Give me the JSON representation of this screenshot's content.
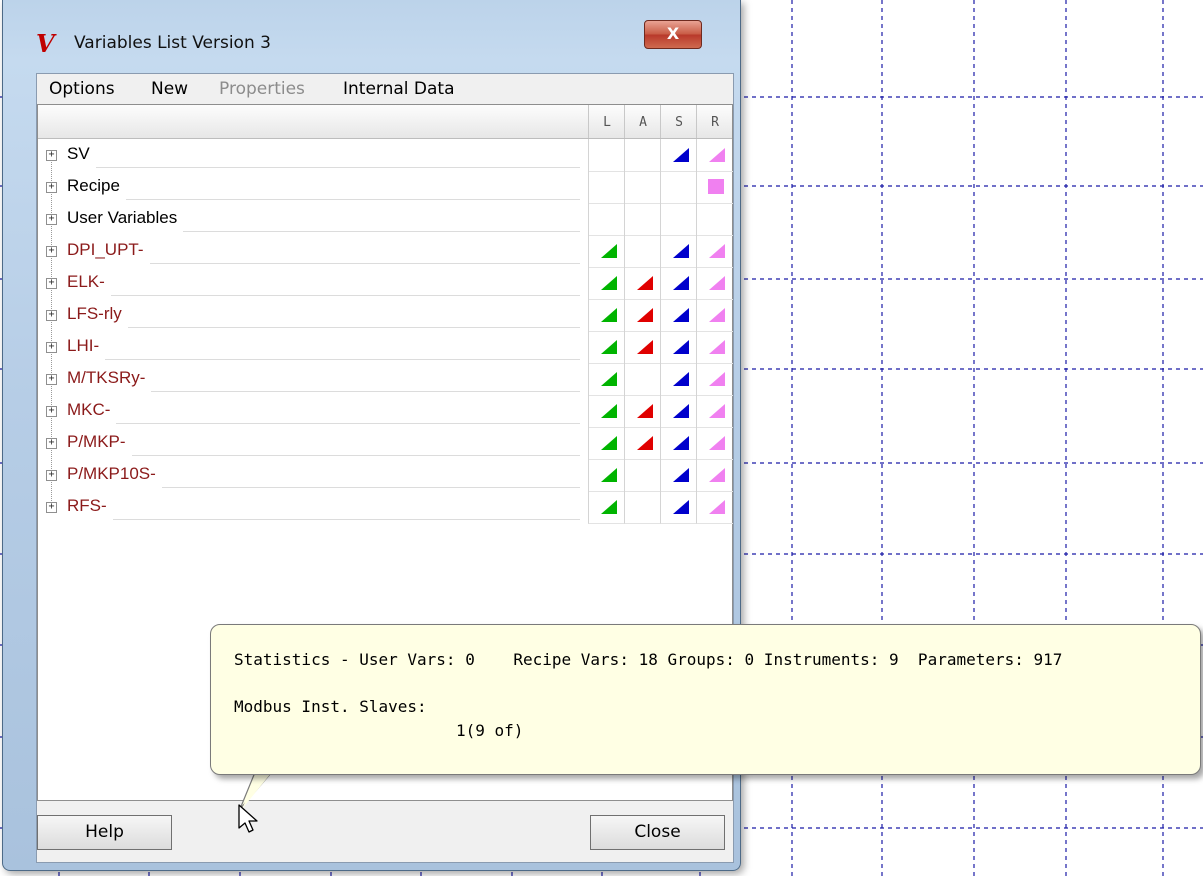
{
  "window": {
    "title": "Variables List Version 3",
    "logo_glyph": "V",
    "close_glyph": "X"
  },
  "menu": [
    {
      "label": "Options",
      "enabled": true
    },
    {
      "label": "New",
      "enabled": true
    },
    {
      "label": "Properties",
      "enabled": false
    },
    {
      "label": "Internal Data",
      "enabled": true
    }
  ],
  "columns": [
    "L",
    "A",
    "S",
    "R"
  ],
  "rows": [
    {
      "label": "SV",
      "type": "group",
      "L": "",
      "A": "",
      "S": "tri",
      "R": "tri"
    },
    {
      "label": "Recipe",
      "type": "group",
      "L": "",
      "A": "",
      "S": "",
      "R": "square"
    },
    {
      "label": "User Variables",
      "type": "group",
      "L": "",
      "A": "",
      "S": "",
      "R": ""
    },
    {
      "label": "DPI_UPT-",
      "type": "device",
      "L": "tri",
      "A": "",
      "S": "tri",
      "R": "tri"
    },
    {
      "label": "ELK-",
      "type": "device",
      "L": "tri",
      "A": "tri",
      "S": "tri",
      "R": "tri"
    },
    {
      "label": "LFS-rly",
      "type": "device",
      "L": "tri",
      "A": "tri",
      "S": "tri",
      "R": "tri"
    },
    {
      "label": "LHI-",
      "type": "device",
      "L": "tri",
      "A": "tri",
      "S": "tri",
      "R": "tri"
    },
    {
      "label": "M/TKSRy-",
      "type": "device",
      "L": "tri",
      "A": "",
      "S": "tri",
      "R": "tri"
    },
    {
      "label": "MKC-",
      "type": "device",
      "L": "tri",
      "A": "tri",
      "S": "tri",
      "R": "tri"
    },
    {
      "label": "P/MKP-",
      "type": "device",
      "L": "tri",
      "A": "tri",
      "S": "tri",
      "R": "tri"
    },
    {
      "label": "P/MKP10S-",
      "type": "device",
      "L": "tri",
      "A": "",
      "S": "tri",
      "R": "tri"
    },
    {
      "label": "RFS-",
      "type": "device",
      "L": "tri",
      "A": "",
      "S": "tri",
      "R": "tri"
    }
  ],
  "column_colors": {
    "L": "#00b400",
    "A": "#e00000",
    "S": "#0000cc",
    "R": "#f080f0"
  },
  "buttons": {
    "help": "Help",
    "close": "Close"
  },
  "tooltip": {
    "line1": "Statistics - User Vars: 0    Recipe Vars: 18 Groups: 0 Instruments: 9  Parameters: 917",
    "line2": "Modbus Inst. Slaves:",
    "line3": "1(9 of)"
  },
  "icons": {
    "expand": "plus-box-icon",
    "cursor": "mouse-pointer-icon",
    "logo": "app-logo-icon"
  }
}
